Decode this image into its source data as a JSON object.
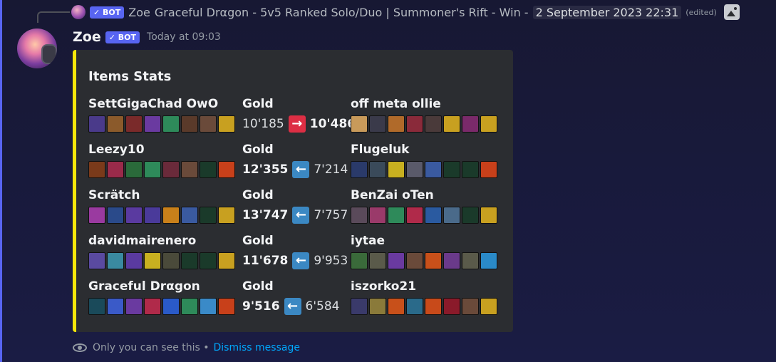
{
  "reply": {
    "bot_tag": "✓ BOT",
    "author": "Zoe",
    "text": "Graceful Drαgon - 5v5 Ranked Solo/Duo | Summoner's Rift - Win -",
    "date": "2 September 2023 22:31",
    "edited": "(edited)"
  },
  "message": {
    "username": "Zoe",
    "bot_tag": "✓ BOT",
    "timestamp": "Today at 09:03"
  },
  "embed": {
    "accent_color": "#f5e70a",
    "title": "Items Stats",
    "gold_label": "Gold",
    "rows": [
      {
        "left_player": "SettGigaChad OwO",
        "left_items": [
          "#4a3a8a",
          "#8b5a2b",
          "#7a2a2a",
          "#6a3aa0",
          "#2e8a5a",
          "#5a3a2a",
          "#6a4a3a",
          "#c8a020"
        ],
        "gold_left": "10'185",
        "arrow": "→",
        "arrow_dir": "right",
        "gold_right": "10'486",
        "bold_side": "right",
        "right_player": "off meta ollie",
        "right_items": [
          "#c89a5a",
          "#3a3a4a",
          "#b06a2a",
          "#8a2a3a",
          "#4a3a3a",
          "#c8a020",
          "#7a2a6a",
          "#c8a020"
        ]
      },
      {
        "left_player": "Leezy10",
        "left_items": [
          "#7a3a1a",
          "#9a2a4a",
          "#2a6a3a",
          "#2e8a5a",
          "#6a2a3a",
          "#6a4a3a",
          "#1a3a2a",
          "#c8401a"
        ],
        "gold_left": "12'355",
        "arrow": "←",
        "arrow_dir": "left",
        "gold_right": "7'214",
        "bold_side": "left",
        "right_player": "Flugeluk",
        "right_items": [
          "#2a3a6a",
          "#3a4a5a",
          "#c8b020",
          "#5a5a6a",
          "#3a5aa0",
          "#1a3a2a",
          "#1a3a2a",
          "#c8401a"
        ]
      },
      {
        "left_player": "Scrätch",
        "left_items": [
          "#9a3aa0",
          "#2a4a8a",
          "#5a3aa0",
          "#4a3a9a",
          "#c8801a",
          "#3a5aa0",
          "#1a3a2a",
          "#c8a020"
        ],
        "gold_left": "13'747",
        "arrow": "←",
        "arrow_dir": "left",
        "gold_right": "7'757",
        "bold_side": "left",
        "right_player": "BenZai oTen",
        "right_items": [
          "#5a4a5a",
          "#9a3a6a",
          "#2e8a5a",
          "#b02a4a",
          "#2a5aa0",
          "#4a6a8a",
          "#1a3a2a",
          "#c8a020"
        ]
      },
      {
        "left_player": "davidmairenero",
        "left_items": [
          "#5a4aa0",
          "#3a8aa0",
          "#5a3aa0",
          "#c8b020",
          "#4a4a3a",
          "#1a3a2a",
          "#1a3a2a",
          "#c8a020"
        ],
        "gold_left": "11'678",
        "arrow": "←",
        "arrow_dir": "left",
        "gold_right": "9'953",
        "bold_side": "left",
        "right_player": "iytae",
        "right_items": [
          "#3a6a3a",
          "#5a5a4a",
          "#6a3aa0",
          "#6a4a3a",
          "#c8501a",
          "#6a3a8a",
          "#5a5a4a",
          "#2a8ac8"
        ]
      },
      {
        "left_player": "Graceful Drαgon",
        "left_items": [
          "#1a4a5a",
          "#3a5ac8",
          "#6a3aa0",
          "#b02a4a",
          "#2a5ac8",
          "#2e8a5a",
          "#3a8ac8",
          "#c8401a"
        ],
        "gold_left": "9'516",
        "arrow": "←",
        "arrow_dir": "left",
        "gold_right": "6'584",
        "bold_side": "left",
        "right_player": "iszorko21",
        "right_items": [
          "#3a3a6a",
          "#8a7a3a",
          "#c8501a",
          "#2a6a8a",
          "#c84a1a",
          "#8a1a2a",
          "#6a4a3a",
          "#c8a020"
        ]
      }
    ]
  },
  "footer": {
    "notice": "Only you can see this •",
    "dismiss": "Dismiss message"
  }
}
